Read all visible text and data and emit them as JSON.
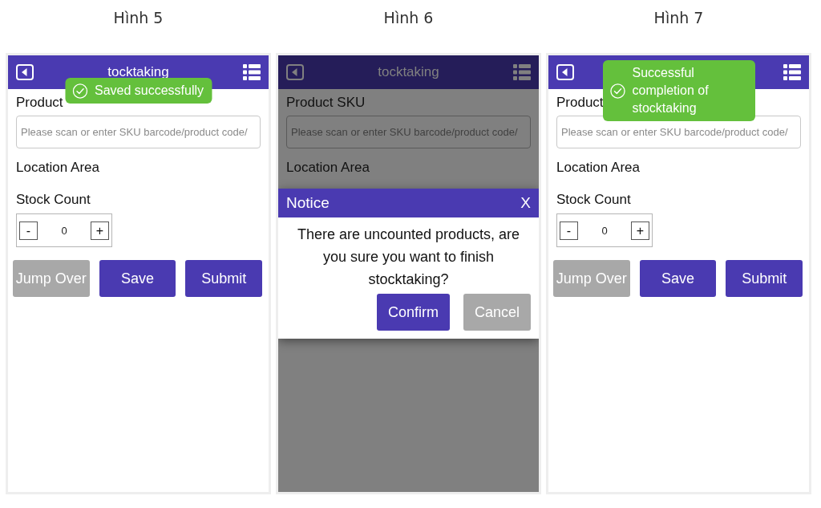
{
  "panels": [
    {
      "caption": "Hình 5",
      "title": "tocktaking",
      "product_sku": {
        "label": "Product",
        "placeholder": "Please scan or enter SKU barcode/product code/"
      },
      "location_area": {
        "label": "Location Area"
      },
      "stock_count": {
        "label": "Stock Count",
        "minus": "-",
        "value": "0",
        "plus": "+"
      },
      "buttons": [
        {
          "label": "Jump Over",
          "disabled": true
        },
        {
          "label": "Save",
          "disabled": false
        },
        {
          "label": "Submit",
          "disabled": false
        }
      ],
      "toast": {
        "message": "Saved successfully"
      }
    },
    {
      "caption": "Hình 6",
      "title": "tocktaking",
      "product_sku": {
        "label": "Product SKU",
        "placeholder": "Please scan or enter SKU barcode/product code/"
      },
      "location_area": {
        "label": "Location Area"
      },
      "dialog": {
        "title": "Notice",
        "close": "X",
        "message": "There are uncounted products, are you sure you want to finish stocktaking?",
        "buttons": [
          {
            "label": "Confirm",
            "disabled": false
          },
          {
            "label": "Cancel",
            "disabled": true
          }
        ]
      }
    },
    {
      "caption": "Hình 7",
      "product_sku": {
        "label": "Product",
        "placeholder": "Please scan or enter SKU barcode/product code/"
      },
      "location_area": {
        "label": "Location Area"
      },
      "stock_count": {
        "label": "Stock Count",
        "minus": "-",
        "value": "0",
        "plus": "+"
      },
      "buttons": [
        {
          "label": "Jump Over",
          "disabled": true
        },
        {
          "label": "Save",
          "disabled": false
        },
        {
          "label": "Submit",
          "disabled": false
        }
      ],
      "toast": {
        "message": "Successful completion of stocktaking"
      }
    }
  ]
}
